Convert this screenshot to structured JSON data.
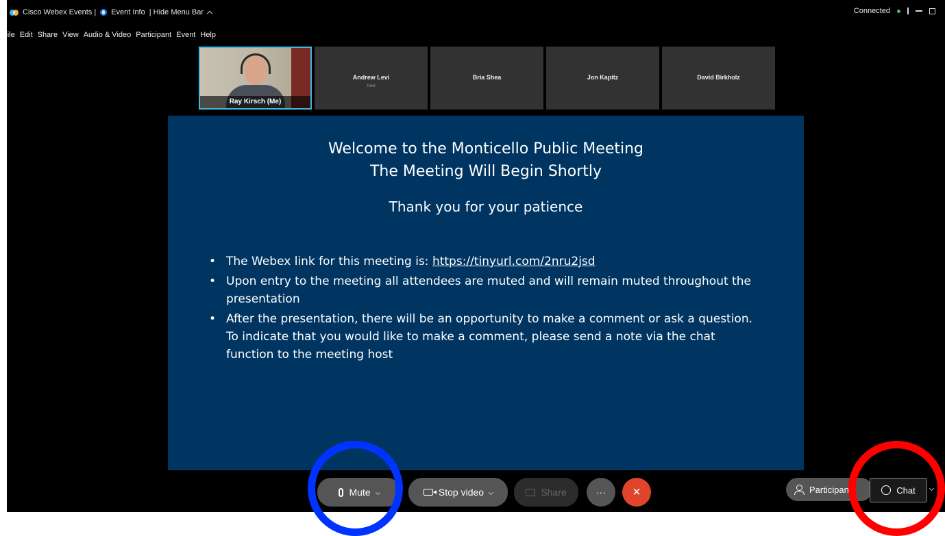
{
  "titlebar": {
    "app_name": "Cisco Webex Events |",
    "event_info": "Event Info",
    "hide_menu_bar": "| Hide Menu Bar",
    "connection_status": "Connected"
  },
  "menubar": {
    "items": [
      "File",
      "Edit",
      "Share",
      "View",
      "Audio & Video",
      "Participant",
      "Event",
      "Help"
    ]
  },
  "participants": [
    {
      "name": "Ray Kirsch  (Me)",
      "role": ""
    },
    {
      "name": "Andrew Levi",
      "role": "Host"
    },
    {
      "name": "Bria Shea",
      "role": ""
    },
    {
      "name": "Jon Kapitz",
      "role": ""
    },
    {
      "name": "David Birkholz",
      "role": ""
    }
  ],
  "slide": {
    "title_line1": "Welcome to the Monticello Public Meeting",
    "title_line2": "The Meeting Will Begin Shortly",
    "subtitle": "Thank you for your patience",
    "bullet1_text": "The Webex link for this meeting is: ",
    "bullet1_link": "https://tinyurl.com/2nru2jsd",
    "bullet2": "Upon entry to the meeting all attendees are muted and will remain muted throughout the presentation",
    "bullet3": "After the presentation, there will be an opportunity to make a comment or ask a question.  To indicate that you would like to make a comment, please send a note via the chat function to the meeting host"
  },
  "controls": {
    "mute_label": "Mute",
    "stop_video_label": "Stop video",
    "share_label": "Share",
    "more_label": "···",
    "leave_label": "×",
    "participants_label": "Participants",
    "chat_label": "Chat"
  },
  "colors": {
    "slide_bg": "#003562",
    "leave_red": "#e0452c",
    "annotation_blue": "#0033ff",
    "annotation_red": "#ff0000"
  }
}
